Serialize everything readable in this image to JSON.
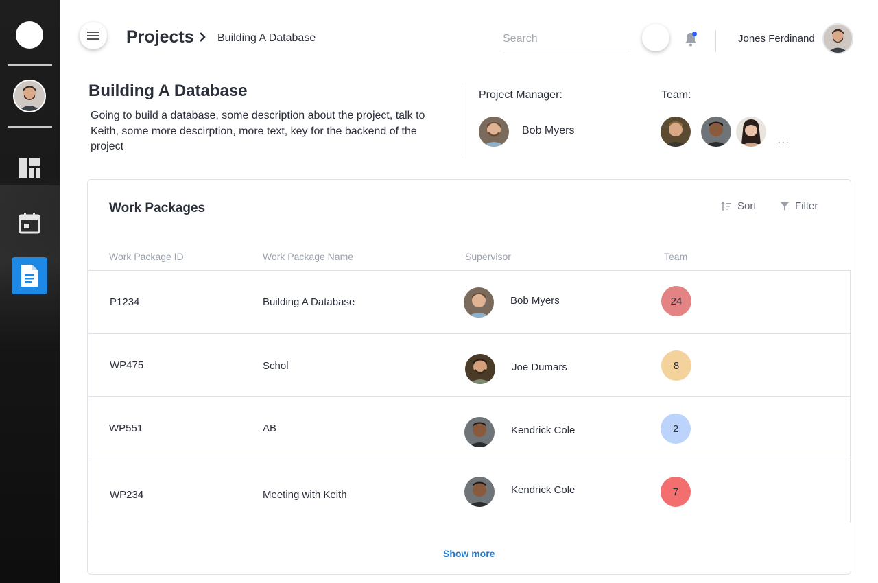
{
  "breadcrumb": {
    "root": "Projects",
    "current": "Building A Database"
  },
  "search": {
    "placeholder": "Search",
    "value": ""
  },
  "user": {
    "name": "Jones Ferdinand"
  },
  "sidebar": {
    "items": [
      {
        "icon": "dashboard-icon",
        "active": false
      },
      {
        "icon": "calendar-icon",
        "active": false
      },
      {
        "icon": "document-icon",
        "active": true
      }
    ],
    "accent": "#1e88e5"
  },
  "project": {
    "title": "Building A Database",
    "description": "Going to build a database, some description about the project, talk to Keith, some more descirption, more text, key for the backend of the project",
    "manager_label": "Project Manager:",
    "manager_name": "Bob Myers",
    "team_label": "Team:",
    "team_more": "..."
  },
  "packages": {
    "title": "Work Packages",
    "sort_label": "Sort",
    "filter_label": "Filter",
    "columns": [
      "Work Package ID",
      "Work Package Name",
      "Supervisor",
      "Team"
    ],
    "rows": [
      {
        "id": "P1234",
        "name": "Building A Database",
        "supervisor": "Bob Myers",
        "team": "24",
        "color": "#e38383"
      },
      {
        "id": "WP475",
        "name": "Schol",
        "supervisor": "Joe Dumars",
        "team": "8",
        "color": "#f4d29b"
      },
      {
        "id": "WP551",
        "name": "AB",
        "supervisor": "Kendrick Cole",
        "team": "2",
        "color": "#bcd3fb"
      },
      {
        "id": "WP234",
        "name": "Meeting with Keith",
        "supervisor": "Kendrick Cole",
        "team": "7",
        "color": "#f36e6e"
      }
    ],
    "show_more": "Show more"
  }
}
